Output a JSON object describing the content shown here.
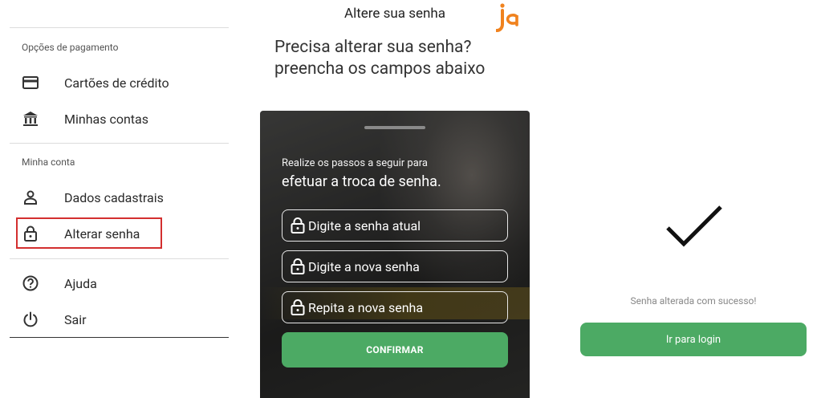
{
  "menu": {
    "section_payment": "Opções de pagamento",
    "section_account": "Minha conta",
    "items": [
      {
        "id": "credit-cards",
        "label": "Cartões de crédito",
        "icon": "credit-card-icon"
      },
      {
        "id": "my-accounts",
        "label": "Minhas contas",
        "icon": "bank-icon"
      },
      {
        "id": "profile-data",
        "label": "Dados cadastrais",
        "icon": "person-icon"
      },
      {
        "id": "change-password",
        "label": "Alterar senha",
        "icon": "lock-icon",
        "highlighted": true
      },
      {
        "id": "help",
        "label": "Ajuda",
        "icon": "help-circle-icon"
      },
      {
        "id": "logout",
        "label": "Sair",
        "icon": "power-icon"
      }
    ]
  },
  "change_password": {
    "title": "Altere sua senha",
    "logo_text": "ja",
    "headline_line1": "Precisa alterar sua senha?",
    "headline_line2": "preencha os campos abaixo",
    "card": {
      "subtitle": "Realize os passos a seguir para",
      "subtitle_emphasis": "efetuar a troca de senha.",
      "fields": {
        "current": "Digite a senha atual",
        "new": "Digite a nova senha",
        "repeat": "Repita a nova senha"
      },
      "confirm_label": "CONFIRMAR"
    }
  },
  "success": {
    "message": "Senha alterada com sucesso!",
    "login_label": "Ir para login"
  },
  "colors": {
    "accent_green": "#4caa64",
    "highlight_red": "#d32f2f",
    "logo_orange": "#f0821e"
  }
}
